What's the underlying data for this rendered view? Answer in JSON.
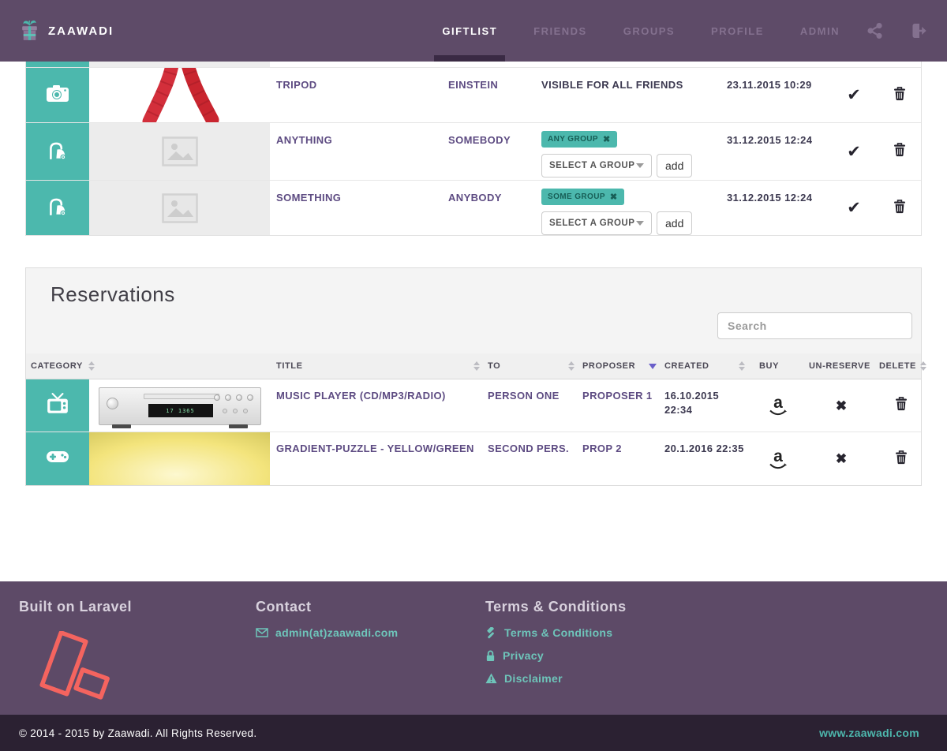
{
  "brand": {
    "name": "ZAAWADI"
  },
  "nav": {
    "giftlist": "GIFTLIST",
    "friends": "FRIENDS",
    "groups": "GROUPS",
    "profile": "PROFILE",
    "admin": "ADMIN"
  },
  "icons": {
    "check": "✔",
    "remove_tag": "✖",
    "unreserve": "✖",
    "amazon_letter": "a"
  },
  "giftlist": {
    "rows": [
      {
        "category": "camera",
        "title": "TRIPOD",
        "to": "EINSTEIN",
        "visibility": "VISIBLE FOR ALL FRIENDS",
        "created": "23.11.2015 10:29"
      },
      {
        "category": "vacuum",
        "title": "ANYTHING",
        "to": "SOMEBODY",
        "group_tag": "ANY GROUP",
        "select_placeholder": "SELECT A GROUP",
        "add_label": "add",
        "created": "31.12.2015 12:24"
      },
      {
        "category": "vacuum",
        "title": "SOMETHING",
        "to": "ANYBODY",
        "group_tag": "SOME GROUP",
        "select_placeholder": "SELECT A GROUP",
        "add_label": "add",
        "created": "31.12.2015 12:24"
      }
    ]
  },
  "reservations": {
    "title": "Reservations",
    "search_placeholder": "Search",
    "headers": {
      "category": "CATEGORY",
      "gift_title": "TITLE",
      "to": "TO",
      "proposer": "PROPOSER",
      "created": "CREATED",
      "buy": "BUY",
      "unreserve": "UN-RESERVE",
      "delete": "DELETE"
    },
    "sorted_by": "PROPOSER",
    "rows": [
      {
        "category": "tv",
        "title": "MUSIC PLAYER (CD/MP3/RADIO)",
        "to": "PERSON ONE",
        "proposer": "PROPOSER 1",
        "created": "16.10.2015 22:34",
        "image_display": "17 1365"
      },
      {
        "category": "gamepad",
        "title": "GRADIENT-PUZZLE - YELLOW/GREEN",
        "to": "SECOND PERS.",
        "proposer": "PROP 2",
        "created": "20.1.2016 22:35"
      }
    ]
  },
  "footer": {
    "built_heading": "Built on Laravel",
    "contact_heading": "Contact",
    "contact_email": "admin(at)zaawadi.com",
    "terms_heading": "Terms & Conditions",
    "links": {
      "terms": "Terms & Conditions",
      "privacy": "Privacy",
      "disclaimer": "Disclaimer"
    }
  },
  "copyright": {
    "text": "© 2014 - 2015 by Zaawadi. All Rights Reserved.",
    "site": "www.zaawadi.com"
  },
  "colors": {
    "accent_teal": "#4cb8ad",
    "nav_purple": "#5e4b68",
    "dark_bar": "#2b2132",
    "link_purple": "#5d4b82",
    "laravel_red": "#f4645f"
  }
}
